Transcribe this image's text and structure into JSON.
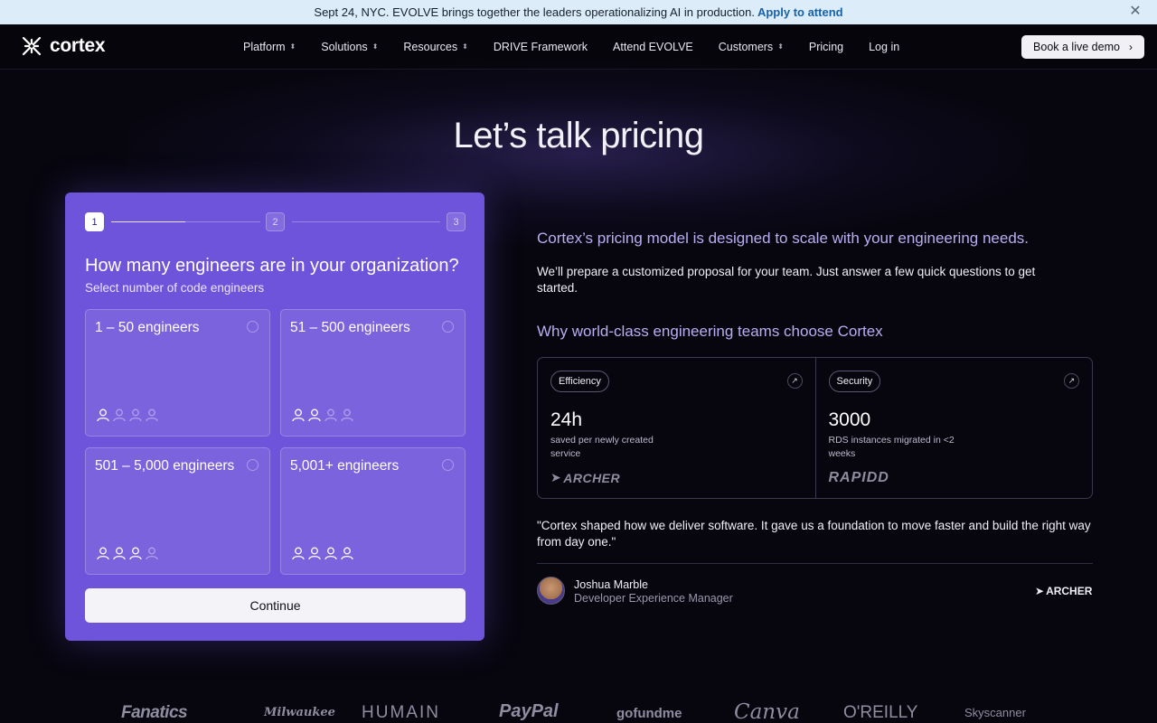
{
  "banner": {
    "text": "Sept 24, NYC. EVOLVE brings together the leaders operationalizing AI in production.",
    "cta": "Apply to attend",
    "close_icon": "close-icon"
  },
  "nav": {
    "logo_text": "cortex",
    "items": [
      {
        "label": "Platform",
        "has_dropdown": true
      },
      {
        "label": "Solutions",
        "has_dropdown": true
      },
      {
        "label": "Resources",
        "has_dropdown": true
      },
      {
        "label": "DRIVE Framework",
        "has_dropdown": false
      },
      {
        "label": "Attend EVOLVE",
        "has_dropdown": false
      },
      {
        "label": "Customers",
        "has_dropdown": true
      },
      {
        "label": "Pricing",
        "has_dropdown": false
      },
      {
        "label": "Log in",
        "has_dropdown": false
      }
    ],
    "cta": "Book a live demo"
  },
  "hero": {
    "title": "Let’s talk pricing"
  },
  "form": {
    "steps": [
      "1",
      "2",
      "3"
    ],
    "current_step": 1,
    "question": "How many engineers are in your organization?",
    "subtitle": "Select number of code engineers",
    "options": [
      {
        "label": "1 – 50 engineers",
        "level": 1,
        "of": 4
      },
      {
        "label": "51 – 500 engineers",
        "level": 2,
        "of": 4
      },
      {
        "label": "501 – 5,000 engineers",
        "level": 3,
        "of": 4
      },
      {
        "label": "5,001+ engineers",
        "level": 4,
        "of": 4
      }
    ],
    "continue_label": "Continue"
  },
  "info": {
    "heading": "Cortex’s pricing model is designed to scale with your engineering needs.",
    "description": "We’ll prepare a customized proposal for your team. Just answer a few quick questions to get started.",
    "why_heading": "Why world-class engineering teams choose Cortex",
    "stats": [
      {
        "tag": "Efficiency",
        "value": "24h",
        "caption": "saved per newly created service",
        "logo": "ARCHER"
      },
      {
        "tag": "Security",
        "value": "3000",
        "caption": "RDS instances migrated in <2 weeks",
        "logo": "RAPIDD"
      }
    ],
    "quote": "\"Cortex shaped how we deliver software. It gave us a foundation to move faster and build the right way from day one.\"",
    "person": {
      "name": "Joshua Marble",
      "role": "Developer Experience Manager",
      "company_logo": "ARCHER"
    }
  },
  "customers": [
    "Fanatics",
    "Milwaukee",
    "HUMAIN",
    "PayPal",
    "gofundme",
    "Canva",
    "O'REILLY",
    "Skyscanner"
  ],
  "colors": {
    "accent": "#6e54da",
    "accent_text": "#b8aef2",
    "banner_bg": "#dcecf8",
    "banner_link": "#1762a8"
  }
}
